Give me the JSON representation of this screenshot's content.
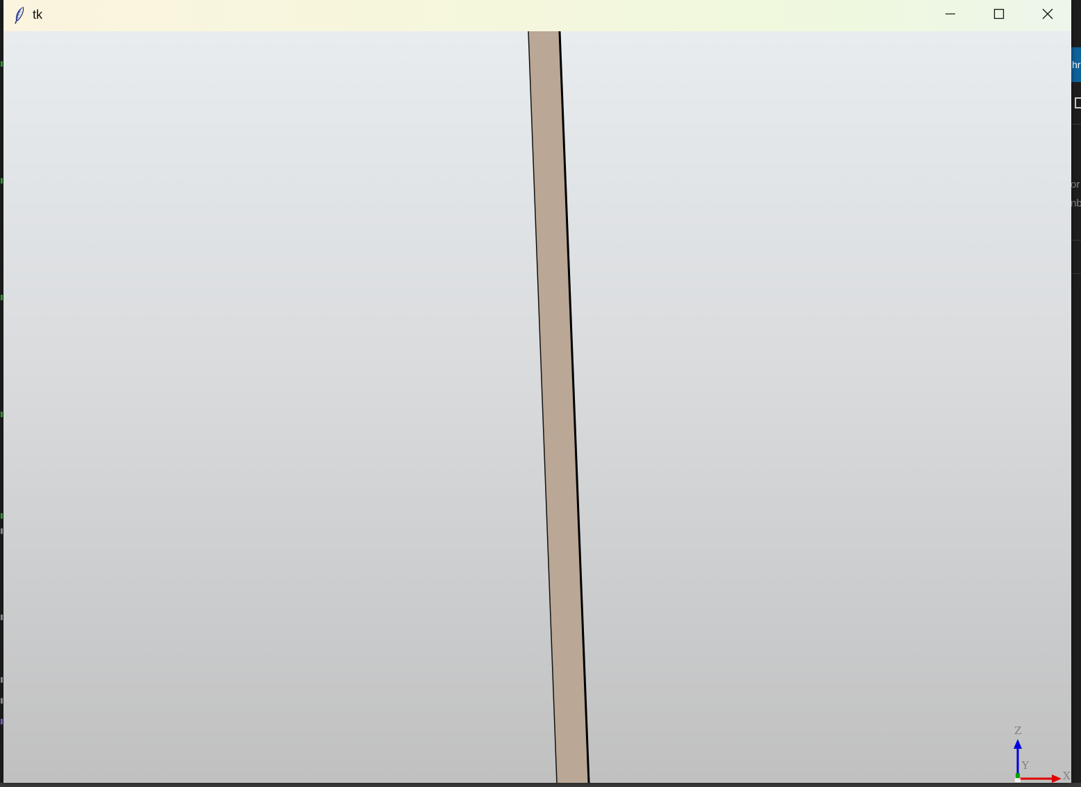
{
  "window": {
    "title": "tk",
    "icon": "tk-feather-icon",
    "controls": {
      "minimize": "minimize-icon",
      "maximize": "maximize-icon",
      "close": "close-icon"
    }
  },
  "viewport": {
    "description_colors": {
      "background_top": "#e8ecef",
      "background_bottom": "#c0c0c0",
      "shape_fill": "#baa796",
      "shape_edge": "#000000"
    },
    "axis_triad": {
      "x_label": "X",
      "y_label": "Y",
      "z_label": "Z",
      "x_color": "#e00000",
      "y_color": "#00a000",
      "z_color": "#0000e0"
    }
  },
  "background_app": {
    "right_button_text": "hr",
    "right_text_lines": [
      "or",
      "nb"
    ]
  }
}
